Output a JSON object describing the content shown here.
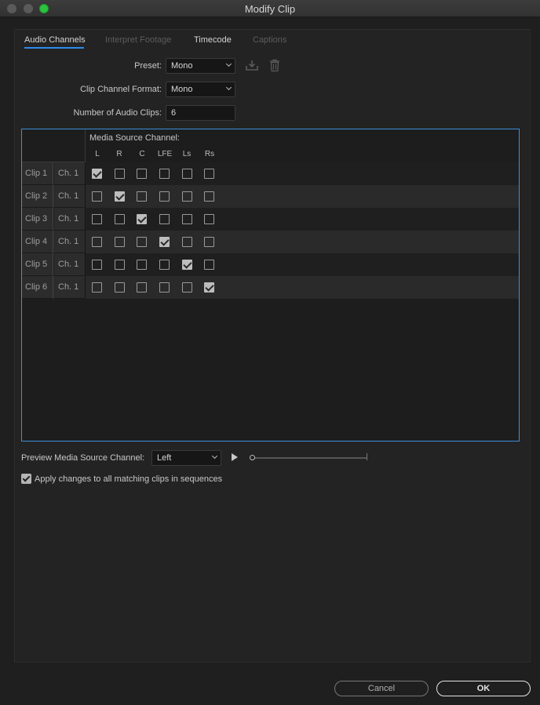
{
  "window": {
    "title": "Modify Clip"
  },
  "tabs": [
    {
      "label": "Audio Channels",
      "active": true
    },
    {
      "label": "Interpret Footage",
      "active": false
    },
    {
      "label": "Timecode",
      "active": false
    },
    {
      "label": "Captions",
      "active": false
    }
  ],
  "form": {
    "preset_label": "Preset:",
    "preset_value": "Mono",
    "format_label": "Clip Channel Format:",
    "format_value": "Mono",
    "count_label": "Number of Audio Clips:",
    "count_value": "6"
  },
  "grid": {
    "header_title": "Media Source Channel:",
    "columns": [
      "L",
      "R",
      "C",
      "LFE",
      "Ls",
      "Rs"
    ],
    "rows": [
      {
        "clip": "Clip 1",
        "channel": "Ch. 1",
        "checked": "L"
      },
      {
        "clip": "Clip 2",
        "channel": "Ch. 1",
        "checked": "R"
      },
      {
        "clip": "Clip 3",
        "channel": "Ch. 1",
        "checked": "C"
      },
      {
        "clip": "Clip 4",
        "channel": "Ch. 1",
        "checked": "LFE"
      },
      {
        "clip": "Clip 5",
        "channel": "Ch. 1",
        "checked": "Ls"
      },
      {
        "clip": "Clip 6",
        "channel": "Ch. 1",
        "checked": "Rs"
      }
    ]
  },
  "preview": {
    "label": "Preview Media Source Channel:",
    "value": "Left",
    "progress": 0
  },
  "apply": {
    "label": "Apply changes to all matching clips in sequences",
    "checked": true
  },
  "buttons": {
    "cancel": "Cancel",
    "ok": "OK"
  },
  "icons": {
    "save_preset": "save-preset-icon",
    "delete_preset": "trash-icon"
  },
  "colors": {
    "accent": "#2d8ceb",
    "grid_border": "#3d8fd7",
    "ok_border": "#e4e4e4"
  }
}
